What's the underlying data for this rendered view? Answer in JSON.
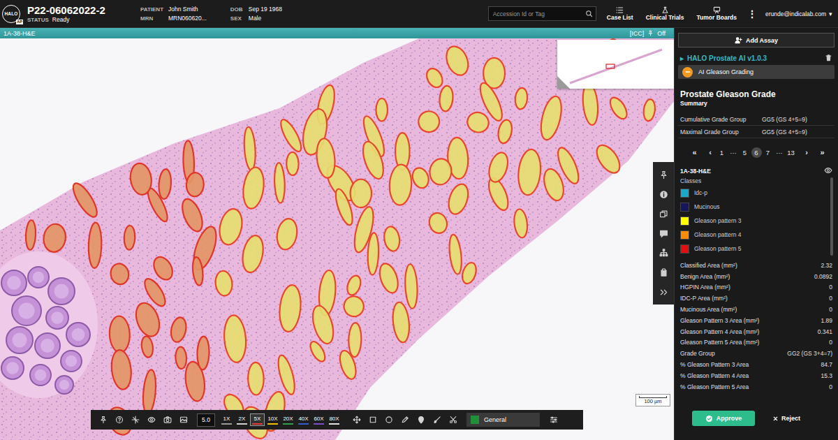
{
  "header": {
    "logo": {
      "text": "HALO",
      "badge": "AP"
    },
    "case_id": "P22-06062022-2",
    "status": {
      "label": "STATUS",
      "value": "Ready"
    },
    "fields": [
      {
        "label": "PATIENT",
        "value": "John Smith"
      },
      {
        "label": "MRN",
        "value": "MRN060620..."
      },
      {
        "label": "DOB",
        "value": "Sep 19 1968"
      },
      {
        "label": "SEX",
        "value": "Male"
      }
    ],
    "search": {
      "placeholder": "Accession Id or Tag"
    },
    "nav": [
      {
        "label": "Case List"
      },
      {
        "label": "Clinical Trials"
      },
      {
        "label": "Tumor Boards"
      }
    ],
    "more": "⋮",
    "user": {
      "email": "erunde@indicalab.com",
      "caret": "▾"
    }
  },
  "viewer": {
    "slide_label": "1A-38-H&E",
    "icc": "[ICC]",
    "pin_state": "Off",
    "scale_bar": "100 µm"
  },
  "toolbar": {
    "magnification": "5.0",
    "zoom": [
      {
        "label": "1X",
        "selected": false,
        "color": "#9a9a9a"
      },
      {
        "label": "2X",
        "selected": false,
        "color": "#cfcfcf"
      },
      {
        "label": "5X",
        "selected": true,
        "color": "#e53935"
      },
      {
        "label": "10X",
        "selected": false,
        "color": "#f2c200"
      },
      {
        "label": "20X",
        "selected": false,
        "color": "#2e9e4f"
      },
      {
        "label": "40X",
        "selected": false,
        "color": "#2f5bd3"
      },
      {
        "label": "60X",
        "selected": false,
        "color": "#7a4bd1"
      },
      {
        "label": "80X",
        "selected": false,
        "color": "#e0e0e0"
      }
    ],
    "class_selector": {
      "label": "General",
      "color": "#1f8f3a"
    }
  },
  "panel": {
    "add_assay": "Add Assay",
    "assay": {
      "expander": "▸",
      "name": "HALO Prostate AI v1.0.3"
    },
    "analysis": "AI Gleason Grading",
    "title": "Prostate Gleason Grade",
    "subtitle": "Summary",
    "summary": [
      {
        "label": "Cumulative Grade Group",
        "value": "GG5 (GS 4+5=9)"
      },
      {
        "label": "Maximal Grade Group",
        "value": "GG5 (GS 4+5=9)"
      }
    ],
    "pagination": [
      {
        "label": "«",
        "kind": "nav",
        "selected": false
      },
      {
        "label": "‹",
        "kind": "nav",
        "selected": false
      },
      {
        "label": "1",
        "kind": "page",
        "selected": false
      },
      {
        "label": "···",
        "kind": "gap",
        "selected": false
      },
      {
        "label": "5",
        "kind": "page",
        "selected": false
      },
      {
        "label": "6",
        "kind": "page",
        "selected": true
      },
      {
        "label": "7",
        "kind": "page",
        "selected": false
      },
      {
        "label": "···",
        "kind": "gap",
        "selected": false
      },
      {
        "label": "13",
        "kind": "page",
        "selected": false
      },
      {
        "label": "›",
        "kind": "nav",
        "selected": false
      },
      {
        "label": "»",
        "kind": "nav",
        "selected": false
      }
    ],
    "slide": {
      "name": "1A-38-H&E",
      "visible": true
    },
    "classes_title": "Classes",
    "classes": [
      {
        "label": "Idc-p",
        "color": "#1aa7c9"
      },
      {
        "label": "Mucinous",
        "color": "#16165c"
      },
      {
        "label": "Gleason pattern 3",
        "color": "#ffff00"
      },
      {
        "label": "Gleason pattern 4",
        "color": "#ff8c00"
      },
      {
        "label": "Gleason pattern 5",
        "color": "#e01010"
      }
    ],
    "metrics": [
      {
        "label": "Classified Area (mm²)",
        "value": "2.32"
      },
      {
        "label": "Benign Area (mm²)",
        "value": "0.0892"
      },
      {
        "label": "HGPIN Area (mm²)",
        "value": "0"
      },
      {
        "label": "IDC-P Area (mm²)",
        "value": "0"
      },
      {
        "label": "Mucinous Area (mm²)",
        "value": "0"
      },
      {
        "label": "Gleason Pattern 3 Area (mm²)",
        "value": "1.89"
      },
      {
        "label": "Gleason Pattern 4 Area (mm²)",
        "value": "0.341"
      },
      {
        "label": "Gleason Pattern 5 Area (mm²)",
        "value": "0"
      },
      {
        "label": "Grade Group",
        "value": "GG2 (GS 3+4=7)"
      },
      {
        "label": "% Gleason Pattern 3 Area",
        "value": "84.7"
      },
      {
        "label": "% Gleason Pattern 4 Area",
        "value": "15.3"
      },
      {
        "label": "% Gleason Pattern 5 Area",
        "value": "0"
      }
    ],
    "approve": "Approve",
    "reject": "Reject"
  }
}
